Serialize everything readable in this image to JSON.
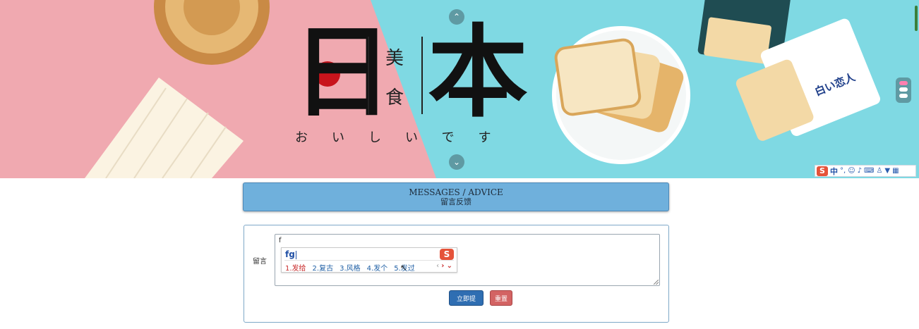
{
  "banner": {
    "logo_left_char": "日",
    "logo_right_char": "本",
    "logo_small_top": "美",
    "logo_small_bottom": "食",
    "logo_kana": "おいしいです",
    "cookie_package_text": "白い恋人",
    "colors": {
      "pink": "#f0a9b0",
      "cyan": "#7fd9e3",
      "sun": "#c8141c"
    }
  },
  "ime_toolbar": {
    "logo": "S",
    "mode": "中",
    "icons": [
      "punctuation-icon",
      "emoji-icon",
      "microphone-icon",
      "keyboard-icon",
      "user-icon",
      "shirt-icon",
      "grid-icon"
    ]
  },
  "messages": {
    "title": "MESSAGES / ADVICE",
    "subtitle": "留言反馈"
  },
  "form": {
    "label": "留言",
    "textarea_value": "f",
    "ime": {
      "input": "fg",
      "logo": "S",
      "candidates": [
        "1.发给",
        "2.复古",
        "3.风格",
        "4.发个",
        "5.发过"
      ]
    },
    "submit_label": "立即提交",
    "reset_label": "重置"
  }
}
